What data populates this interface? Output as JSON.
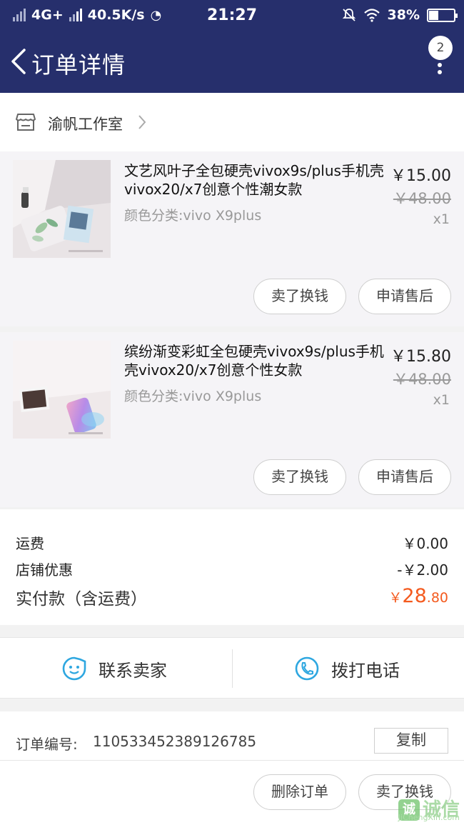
{
  "status_bar": {
    "network": "4G+",
    "speed": "40.5K/s",
    "time": "21:27",
    "battery": "38%",
    "battery_level": 0.38
  },
  "header": {
    "title": "订单详情",
    "badge": "2"
  },
  "shop": {
    "name": "渝帆工作室"
  },
  "items": [
    {
      "title": "文艺风叶子全包硬壳vivox9s/plus手机壳vivox20/x7创意个性潮女款",
      "spec": "颜色分类:vivo X9plus",
      "price": "￥15.00",
      "original_price": "￥48.00",
      "qty": "x1",
      "actions": [
        "卖了换钱",
        "申请售后"
      ]
    },
    {
      "title": "缤纷渐变彩虹全包硬壳vivox9s/plus手机壳vivox20/x7创意个性女款",
      "spec": "颜色分类:vivo X9plus",
      "price": "￥15.80",
      "original_price": "￥48.00",
      "qty": "x1",
      "actions": [
        "卖了换钱",
        "申请售后"
      ]
    }
  ],
  "totals": {
    "shipping_label": "运费",
    "shipping_value": "￥0.00",
    "discount_label": "店铺优惠",
    "discount_value": "-￥2.00",
    "paid_label": "实付款（含运费）",
    "paid_currency": "￥",
    "paid_integer": "28",
    "paid_decimal": ".80",
    "accent_color": "#f45a1e"
  },
  "contact": {
    "seller_label": "联系卖家",
    "phone_label": "拨打电话"
  },
  "order": {
    "number_label": "订单编号:",
    "number": "110533452389126785",
    "copy_label": "复制",
    "actions": [
      "删除订单",
      "卖了换钱"
    ]
  },
  "watermark": {
    "logo": "诚",
    "text": "诚信",
    "domain": "JiChengXin.com"
  },
  "colors": {
    "header_bg": "#262f6c",
    "contact_icon": "#2ea7e0"
  }
}
